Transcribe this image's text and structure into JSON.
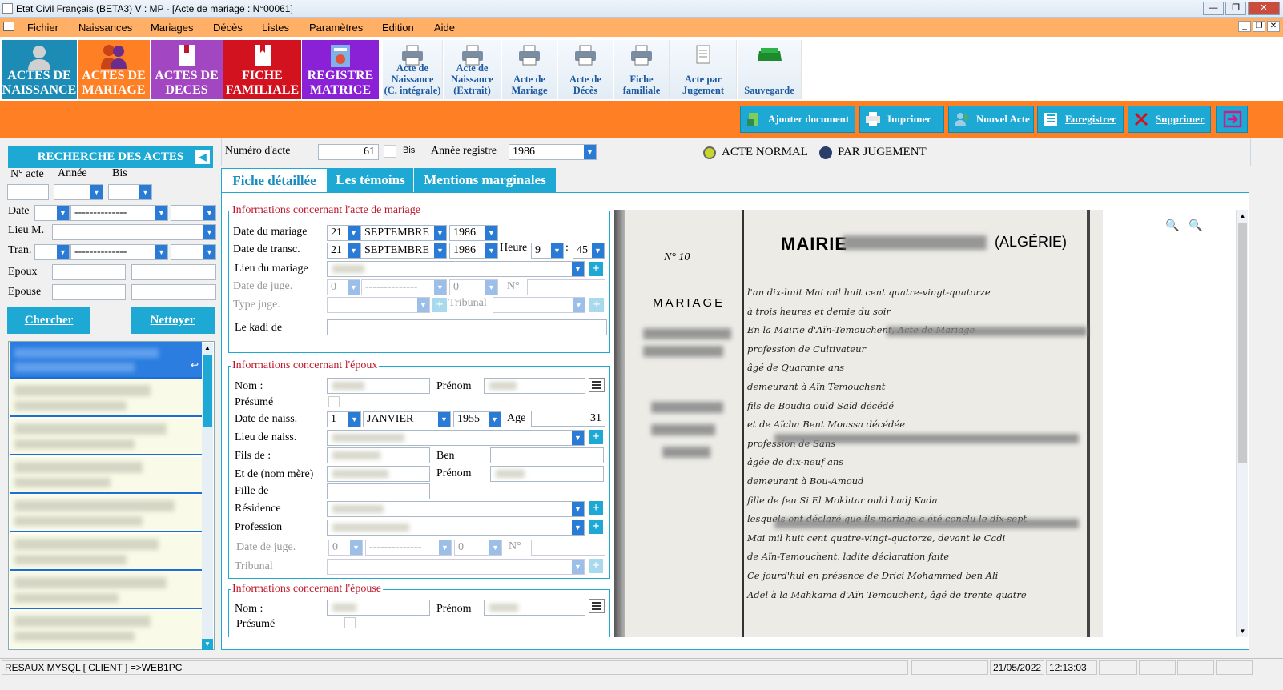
{
  "window": {
    "title": "Etat Civil Français (BETA3)  V : MP  - [Acte de mariage : N°00061]",
    "controls": [
      "—",
      "❐",
      "✕"
    ]
  },
  "menu": [
    "Fichier",
    "Naissances",
    "Mariages",
    "Décès",
    "Listes",
    "Paramètres",
    "Edition",
    "Aide"
  ],
  "ribbon": {
    "big": [
      {
        "line1": "ACTES DE",
        "line2": "NAISSANCE",
        "color": "#1c8cb6",
        "icon": "person-icon"
      },
      {
        "line1": "ACTES DE",
        "line2": "MARIAGE",
        "color": "#ff7f24",
        "icon": "couple-icon"
      },
      {
        "line1": "ACTES DE",
        "line2": "DECES",
        "color": "#a346c1",
        "icon": "book-icon"
      },
      {
        "line1": "FICHE",
        "line2": "FAMILIALE",
        "color": "#d3121f",
        "icon": "bookmark-icon"
      },
      {
        "line1": "REGISTRE",
        "line2": "MATRICE",
        "color": "#8a21d6",
        "icon": "register-icon"
      }
    ],
    "small": [
      {
        "lines": [
          "Acte de",
          "Naissance",
          "(C. intégrale)"
        ],
        "icon": "printer-icon"
      },
      {
        "lines": [
          "Acte de",
          "Naissance",
          "(Extrait)"
        ],
        "icon": "printer-icon"
      },
      {
        "lines": [
          "Acte de",
          "Mariage"
        ],
        "icon": "printer-icon"
      },
      {
        "lines": [
          "Acte de",
          "Décès"
        ],
        "icon": "printer-icon"
      },
      {
        "lines": [
          "Fiche",
          "familiale"
        ],
        "icon": "printer-icon"
      },
      {
        "lines": [
          "Acte par",
          "Jugement"
        ],
        "icon": "document-icon"
      },
      {
        "lines": [
          "Sauvegarde"
        ],
        "icon": "disk-icon"
      }
    ]
  },
  "actions": [
    "Ajouter document",
    "Imprimer",
    "Nouvel Acte",
    "Enregistrer",
    "Supprimer"
  ],
  "search": {
    "title": "RECHERCHE DES ACTES",
    "col_nacte": "N° acte",
    "col_annee": "Année",
    "col_bis": "Bis",
    "date": "Date",
    "date_dashes": "--------------",
    "lieu": "Lieu M.",
    "tran": "Tran.",
    "tran_dashes": "--------------",
    "epoux": "Epoux",
    "epouse": "Epouse",
    "chercher": "Chercher",
    "nettoyer": "Nettoyer"
  },
  "acte": {
    "numero_label": "Numéro d'acte",
    "numero": "61",
    "bis_label": "Bis",
    "annee_label": "Année registre",
    "annee": "1986",
    "normal": "ACTE NORMAL",
    "jugement": "PAR JUGEMENT"
  },
  "tabs": [
    "Fiche détaillée",
    "Les témoins",
    "Mentions marginales"
  ],
  "mariage": {
    "title": "Informations concernant l'acte de mariage",
    "date_label": "Date du mariage",
    "date_day": "21",
    "date_month": "SEPTEMBRE",
    "date_year": "1986",
    "transc_label": "Date de transc.",
    "tr_day": "21",
    "tr_month": "SEPTEMBRE",
    "tr_year": "1986",
    "heure_label": "Heure",
    "heure": "9",
    "colon": ":",
    "minute": "45",
    "lieu_label": "Lieu du mariage",
    "jug_label": "Date de juge.",
    "jug_day": "0",
    "jug_month": "--------------",
    "jug_year": "0",
    "no_label": "N°",
    "type_label": "Type juge.",
    "trib_label": "Tribunal",
    "kadi_label": "Le kadi de"
  },
  "epoux": {
    "title": "Informations concernant l'époux",
    "nom": "Nom :",
    "prenom": "Prénom",
    "presume": "Présumé",
    "naiss_label": "Date de naiss.",
    "n_day": "1",
    "n_month": "JANVIER",
    "n_year": "1955",
    "age_label": "Age",
    "age": "31",
    "lieu_naiss": "Lieu de naiss.",
    "fils": "Fils de :",
    "ben": "Ben",
    "mere": "Et de (nom mère)",
    "prenom2": "Prénom",
    "fille": "Fille de",
    "residence": "Résidence",
    "profession": "Profession",
    "jug_label": "Date de juge.",
    "jug_day": "0",
    "jug_month": "--------------",
    "jug_year": "0",
    "no_label": "N°",
    "tribunal": "Tribunal"
  },
  "epouse": {
    "title": "Informations concernant l'épouse",
    "nom": "Nom :",
    "prenom": "Prénom",
    "presume": "Présumé"
  },
  "document": {
    "mairie": "MAIRIE",
    "algerie": "(ALGÉRIE)",
    "numero": "N° 10",
    "mariage": "MARIAGE",
    "line1": "l'an dix-huit Mai mil huit cent quatre-vingt-quatorze",
    "line2": "à trois heures et demie du soir",
    "line3": "En la Mairie d'Aïn-Temouchent, Acte de Mariage",
    "line4": "profession de Cultivateur",
    "line5": "âgé de Quarante ans",
    "line6": "demeurant à Aïn Temouchent",
    "line7": "fils de Boudia ould Saïd décédé",
    "line8": "et de Aïcha Bent Moussa décédée",
    "line9": "profession de Sans",
    "line10": "âgée de dix-neuf ans",
    "line11": "demeurant à Bou-Amoud",
    "line12": "fille de feu Si El Mokhtar ould hadj Kada",
    "line13": "lesquels ont déclaré que ils mariage a été conclu le dix-sept",
    "line14": "Mai mil huit cent quatre-vingt-quatorze, devant le Cadi",
    "line15": "de Aïn-Temouchent, ladite déclaration faite",
    "line16": "Ce jourd'hui en présence de Drici Mohammed ben Ali",
    "line17": "Adel à la Mahkama d'Aïn Temouchent, âgé de trente quatre"
  },
  "status": {
    "conn": "RESAUX MYSQL [ CLIENT ] =>WEB1PC",
    "date": "21/05/2022",
    "time": "12:13:03"
  }
}
